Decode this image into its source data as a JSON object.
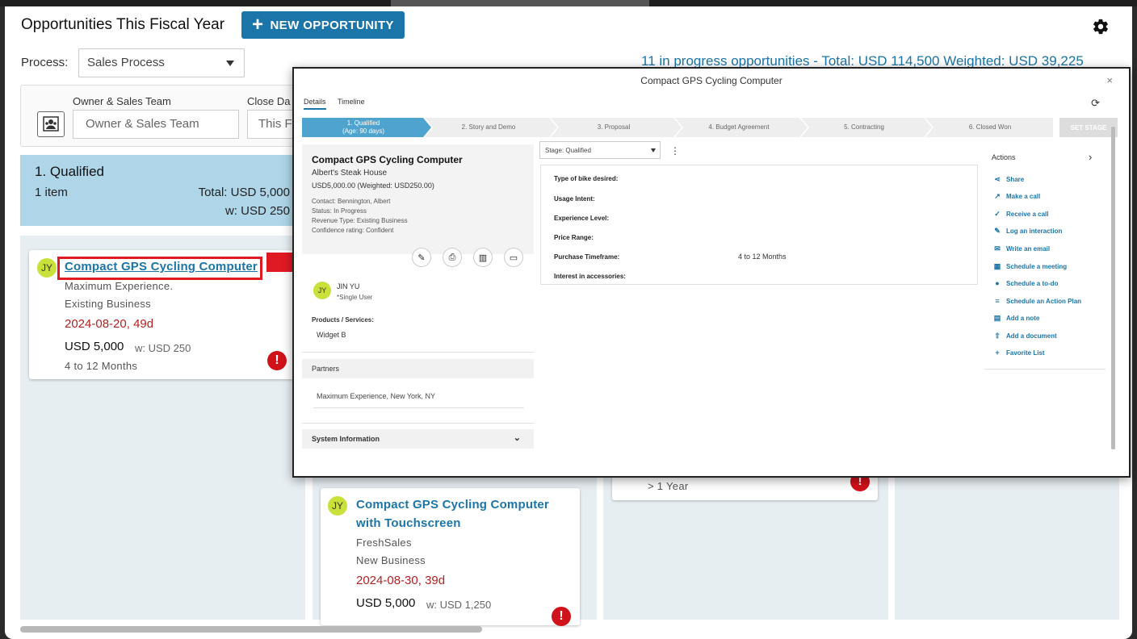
{
  "page": {
    "title": "Opportunities This Fiscal Year",
    "new_button": "NEW OPPORTUNITY",
    "process_label": "Process:",
    "process_value": "Sales Process",
    "summary": "11 in progress opportunities - Total: USD 114,500 Weighted: USD 39,225",
    "owner_label": "Owner & Sales Team",
    "owner_placeholder": "Owner & Sales Team",
    "close_label": "Close Da",
    "close_value": "This F"
  },
  "column1": {
    "title": "1. Qualified",
    "count": "1 item",
    "total": "Total: USD 5,000",
    "weighted": "w: USD 250"
  },
  "cards": [
    {
      "initials": "JY",
      "title": "Compact GPS Cycling Computer",
      "company": "Maximum Experience.",
      "type": "Existing Business",
      "date": "2024-08-20, 49d",
      "amount": "USD 5,000",
      "weighted": "w: USD 250",
      "timeframe": "4 to 12 Months"
    },
    {
      "initials": "JY",
      "title_line1": "Compact GPS Cycling Computer",
      "title_line2": "with Touchscreen",
      "company": "FreshSales",
      "type": "New Business",
      "date": "2024-08-30, 39d",
      "amount": "USD 5,000",
      "weighted": "w: USD 1,250"
    },
    {
      "timeframe": "> 1 Year"
    }
  ],
  "popup": {
    "title": "Compact GPS Cycling Computer",
    "close": "×",
    "tabs": [
      "Details",
      "Timeline"
    ],
    "stages": [
      {
        "name": "1. Qualified",
        "sub": "(Age: 90 days)"
      },
      {
        "name": "2. Story and Demo"
      },
      {
        "name": "3. Proposal"
      },
      {
        "name": "4. Budget Agreement"
      },
      {
        "name": "5. Contracting"
      },
      {
        "name": "6. Closed Won"
      }
    ],
    "set_stage": "SET STAGE",
    "summary": {
      "title": "Compact GPS Cycling Computer",
      "company": "Albert's Steak House",
      "money": "USD5,000.00 (Weighted: USD250.00)",
      "contact": "Contact: Bennington, Albert",
      "status": "Status: In Progress",
      "revenue": "Revenue Type: Existing Business",
      "confidence": "Confidence rating: Confident"
    },
    "owner_initials": "JY",
    "owner_name": "JIN YU",
    "owner_role": "*Single User",
    "products_label": "Products / Services:",
    "products_value": "Widget B",
    "partners_label": "Partners",
    "partners_value": "Maximum Experience, New York, NY",
    "system_label": "System Information",
    "stage_select": "Stage: Qualified",
    "fields": [
      {
        "label": "Type of bike desired:",
        "value": ""
      },
      {
        "label": "Usage Intent:",
        "value": ""
      },
      {
        "label": "Experience Level:",
        "value": ""
      },
      {
        "label": "Price Range:",
        "value": ""
      },
      {
        "label": "Purchase Timeframe:",
        "value": "4 to 12 Months"
      },
      {
        "label": "Interest in accessories:",
        "value": ""
      }
    ],
    "actions_title": "Actions",
    "actions": [
      "Share",
      "Make a call",
      "Receive a call",
      "Log an interaction",
      "Write an email",
      "Schedule a meeting",
      "Schedule a to-do",
      "Schedule an Action Plan",
      "Add a note",
      "Add a document",
      "Favorite List"
    ]
  },
  "colors": {
    "accent": "#1c75a8",
    "column_header": "#aed5e8",
    "column_body": "#e6eef2",
    "date_red": "#b22222",
    "alert_red": "#d0121a",
    "avatar": "#c9e13a"
  }
}
